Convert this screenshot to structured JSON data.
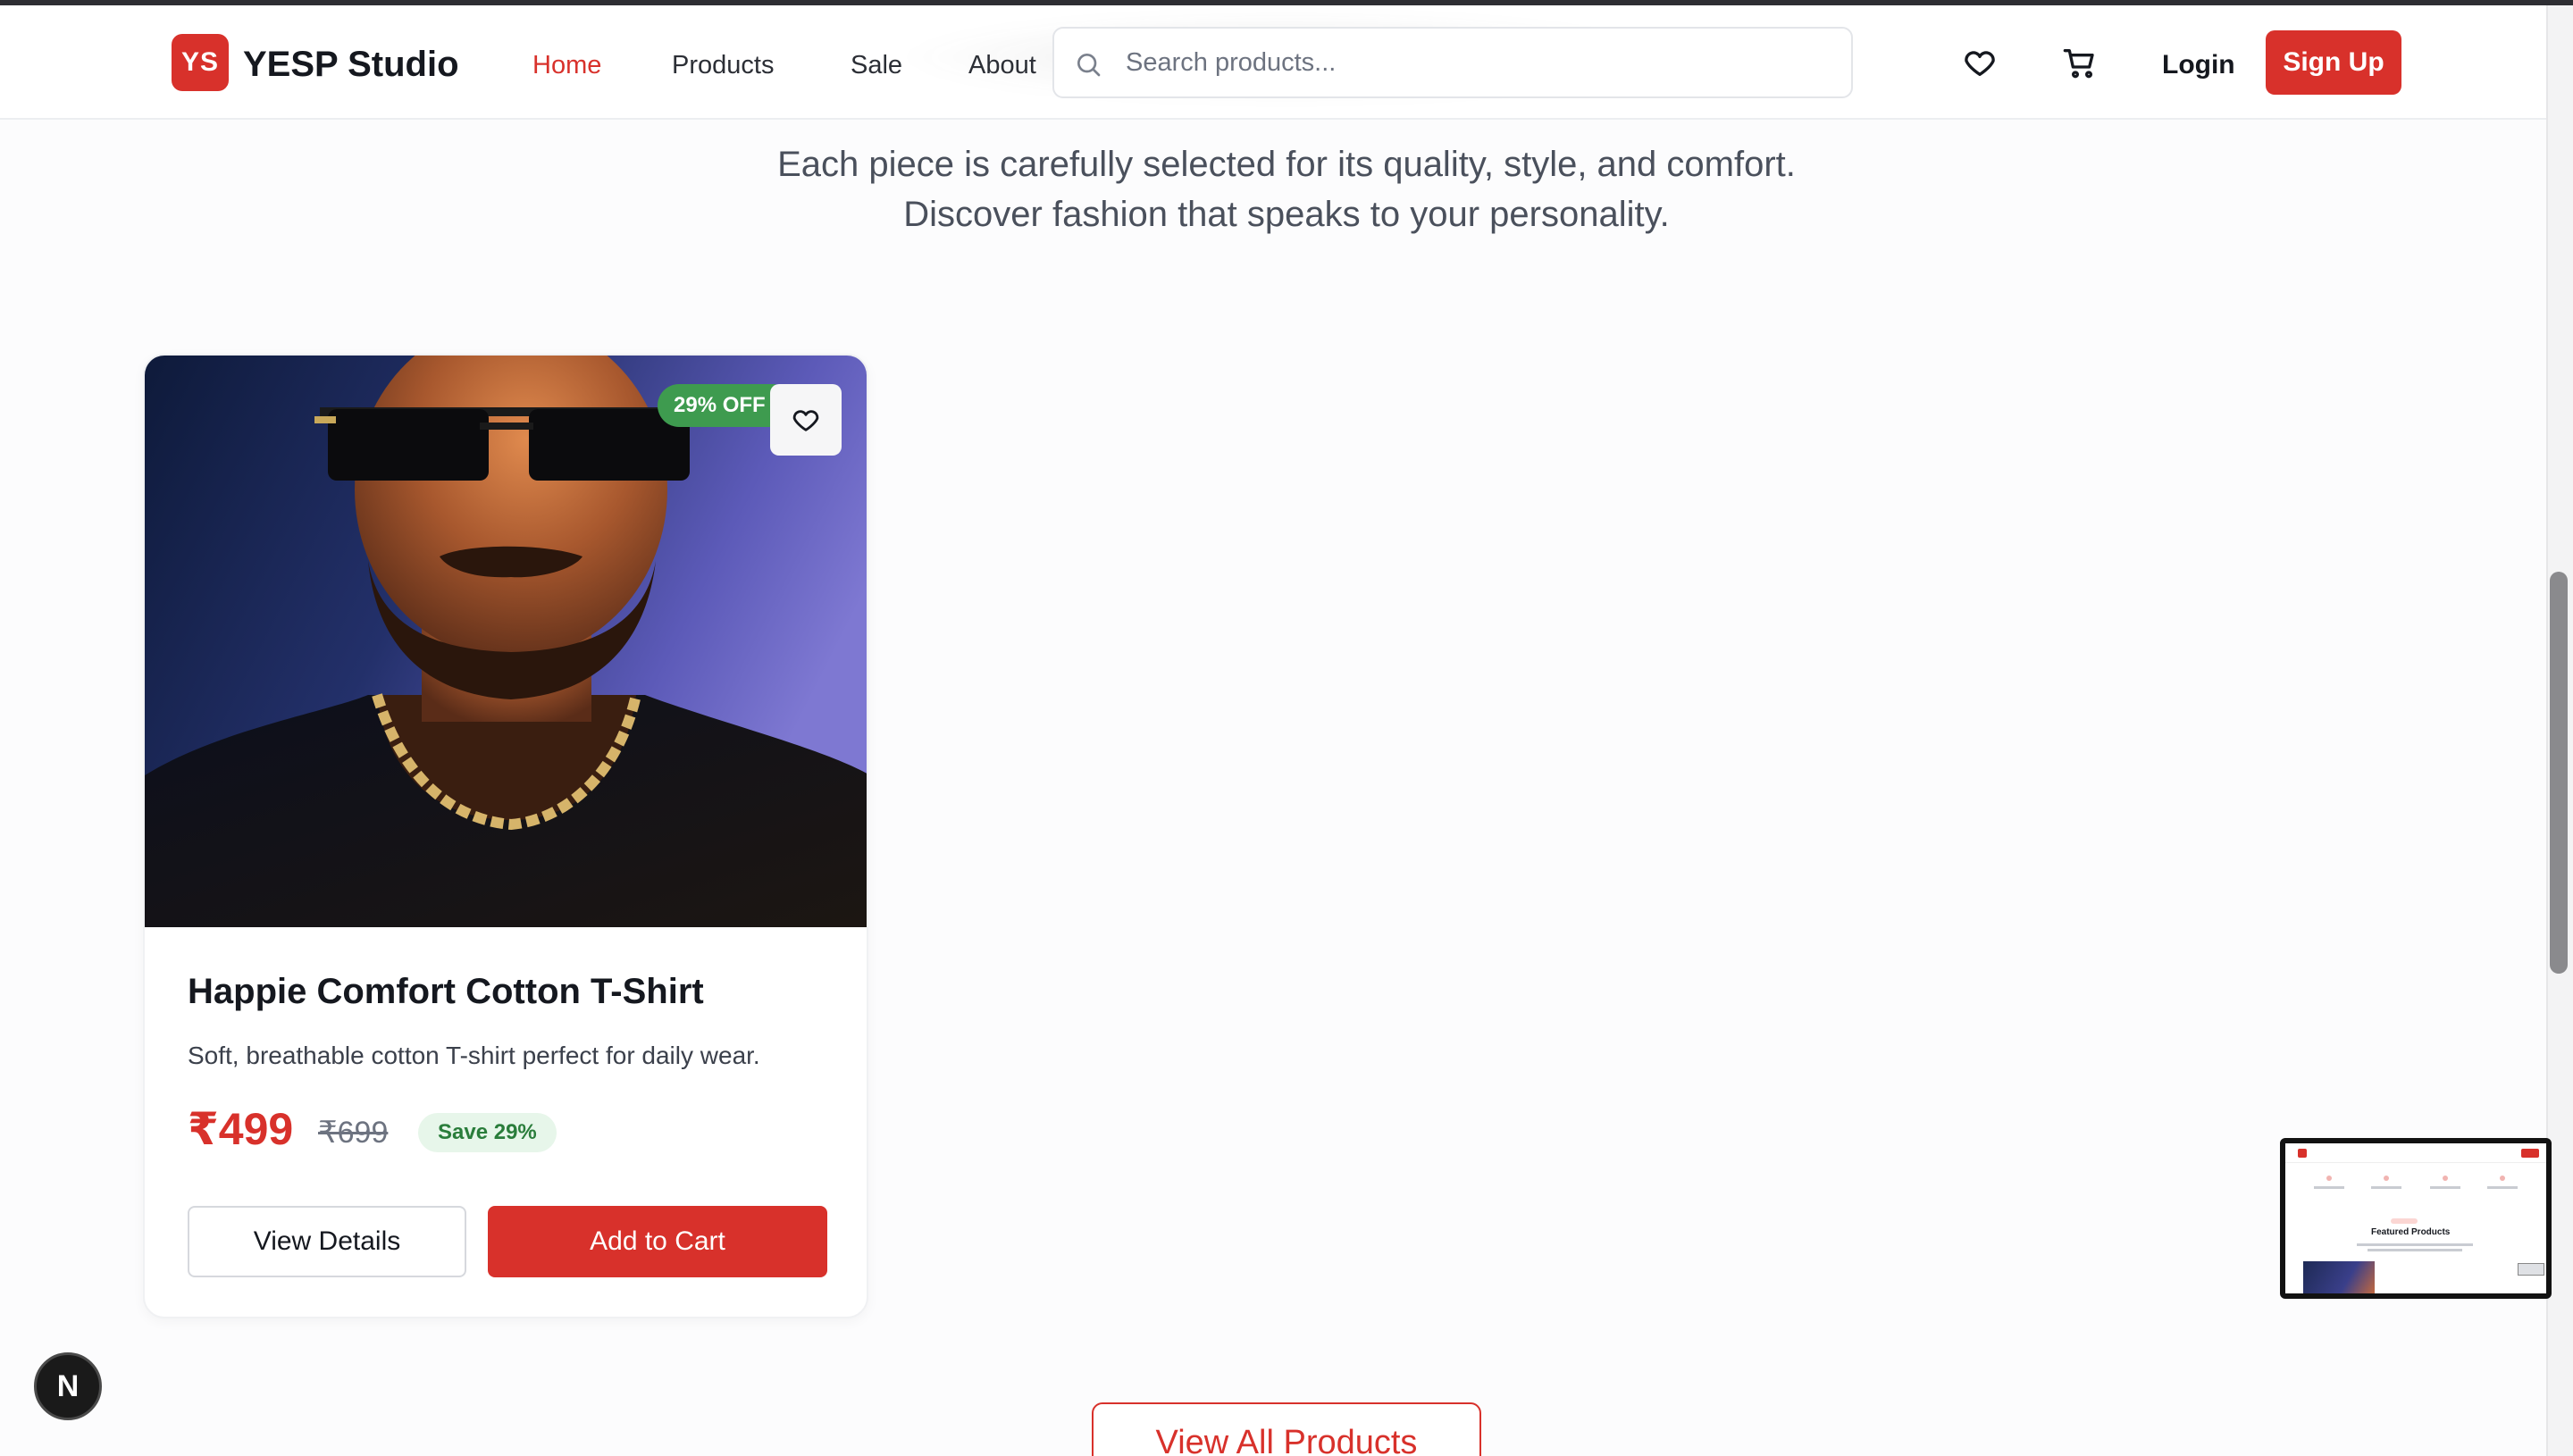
{
  "brand": {
    "logo_text": "YS",
    "name": "YESP Studio",
    "accent": "#d8312b"
  },
  "nav": {
    "items": [
      "Home",
      "Products",
      "Sale",
      "About"
    ],
    "active": "Home"
  },
  "search": {
    "placeholder": "Search products...",
    "value": ""
  },
  "header_actions": {
    "wishlist_icon": "heart-icon",
    "cart_icon": "cart-icon",
    "login_label": "Login",
    "signup_label": "Sign Up"
  },
  "hero": {
    "subtitle_line1": "Each piece is carefully selected for its quality, style, and comfort.",
    "subtitle_line2": "Discover fashion that speaks to your personality."
  },
  "product": {
    "discount_badge": "29% OFF",
    "name": "Happie Comfort Cotton T-Shirt",
    "description": "Soft, breathable cotton T-shirt perfect for daily wear.",
    "price": "₹499",
    "original_price": "₹699",
    "save_label": "Save 29%",
    "view_details_label": "View Details",
    "add_to_cart_label": "Add to Cart"
  },
  "view_all_label": "View All Products",
  "preview_thumbnail": {
    "title": "Featured Products"
  },
  "dev_badge": {
    "letter": "N"
  }
}
